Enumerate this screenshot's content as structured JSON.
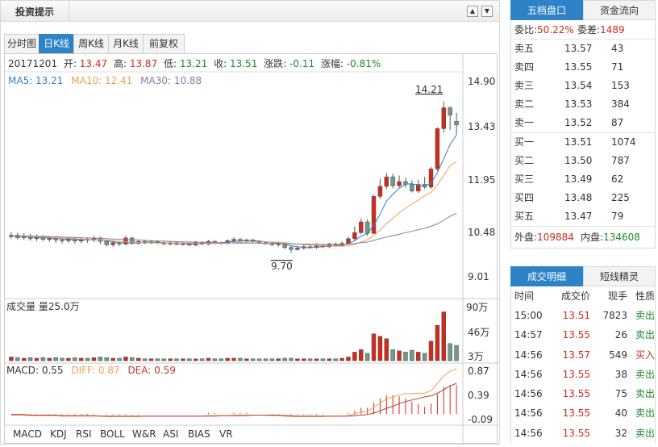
{
  "header": {
    "title": "投资提示",
    "up_icon": "▲",
    "down_icon": "▼"
  },
  "tabs": [
    {
      "label": "分时图",
      "active": false
    },
    {
      "label": "日K线",
      "active": true
    },
    {
      "label": "周K线",
      "active": false
    },
    {
      "label": "月K线",
      "active": false
    },
    {
      "label": "前复权",
      "active": false
    }
  ],
  "quote_line": {
    "date": "20171201",
    "open_label": "开:",
    "open": "13.47",
    "high_label": "高:",
    "high": "13.87",
    "low_label": "低:",
    "low": "13.21",
    "close_label": "收:",
    "close": "13.51",
    "change_label": "涨跌:",
    "change": "-0.11",
    "pct_label": "涨幅:",
    "pct": "-0.81%"
  },
  "ma_line": {
    "ma5": "MA5: 13.21",
    "ma10": "MA10: 12.41",
    "ma30": "MA30: 10.88"
  },
  "price_axis": [
    "14.90",
    "13.43",
    "11.95",
    "10.48",
    "9.01"
  ],
  "annotations": {
    "high_mark": "14.21",
    "low_mark": "9.70"
  },
  "volume": {
    "label": "成交量 量25.0万",
    "axis": [
      "90万",
      "46万",
      "3万"
    ]
  },
  "macd": {
    "macd": "MACD: 0.55",
    "diff": "DIFF: 0.87",
    "dea": "DEA: 0.59",
    "axis": [
      "0.87",
      "0.39",
      "-0.09"
    ]
  },
  "indicator_tabs": [
    "MACD",
    "KDJ",
    "RSI",
    "BOLL",
    "W&R",
    "ASI",
    "BIAS",
    "VR"
  ],
  "order_book": {
    "tabs": [
      {
        "label": "五档盘口",
        "active": true
      },
      {
        "label": "资金流向",
        "active": false
      }
    ],
    "ratio_label": "委比:",
    "ratio": "50.22%",
    "diff_label": "委差:",
    "diff": "1489",
    "sells": [
      {
        "label": "卖五",
        "price": "13.57",
        "qty": "43"
      },
      {
        "label": "卖四",
        "price": "13.55",
        "qty": "71"
      },
      {
        "label": "卖三",
        "price": "13.54",
        "qty": "153"
      },
      {
        "label": "卖二",
        "price": "13.53",
        "qty": "384"
      },
      {
        "label": "卖一",
        "price": "13.52",
        "qty": "87"
      }
    ],
    "buys": [
      {
        "label": "买一",
        "price": "13.51",
        "qty": "1074"
      },
      {
        "label": "买二",
        "price": "13.50",
        "qty": "787"
      },
      {
        "label": "买三",
        "price": "13.49",
        "qty": "62"
      },
      {
        "label": "买四",
        "price": "13.48",
        "qty": "225"
      },
      {
        "label": "买五",
        "price": "13.47",
        "qty": "79"
      }
    ],
    "outer_label": "外盘:",
    "outer": "109884",
    "inner_label": "内盘:",
    "inner": "134608"
  },
  "trades": {
    "tabs": [
      {
        "label": "成交明细",
        "active": true
      },
      {
        "label": "短线精灵",
        "active": false
      }
    ],
    "headers": [
      "时间",
      "成交价",
      "现手",
      "性质"
    ],
    "rows": [
      {
        "time": "15:00",
        "price": "13.51",
        "qty": "7823",
        "type": "卖出"
      },
      {
        "time": "14:57",
        "price": "13.55",
        "qty": "26",
        "type": "卖出"
      },
      {
        "time": "14:56",
        "price": "13.57",
        "qty": "549",
        "type": "买入"
      },
      {
        "time": "14:56",
        "price": "13.55",
        "qty": "38",
        "type": "卖出"
      },
      {
        "time": "14:56",
        "price": "13.55",
        "qty": "75",
        "type": "卖出"
      },
      {
        "time": "14:56",
        "price": "13.55",
        "qty": "40",
        "type": "卖出"
      },
      {
        "time": "14:56",
        "price": "13.55",
        "qty": "32",
        "type": "卖出"
      }
    ]
  },
  "colors": {
    "up": "#d2291a",
    "down": "#6f9a8c",
    "ma5": "#2e83c7",
    "ma10": "#f0a050",
    "ma30": "#8a7aa0",
    "accent": "#2e83c7"
  },
  "chart_data": {
    "type": "candlestick",
    "candles": [
      {
        "o": 10.18,
        "c": 10.22,
        "h": 10.32,
        "l": 10.12,
        "v": 6
      },
      {
        "o": 10.22,
        "c": 10.15,
        "h": 10.3,
        "l": 10.1,
        "v": 5
      },
      {
        "o": 10.15,
        "c": 10.2,
        "h": 10.28,
        "l": 10.08,
        "v": 4
      },
      {
        "o": 10.2,
        "c": 10.12,
        "h": 10.26,
        "l": 10.06,
        "v": 5
      },
      {
        "o": 10.12,
        "c": 10.18,
        "h": 10.24,
        "l": 10.05,
        "v": 4
      },
      {
        "o": 10.18,
        "c": 10.1,
        "h": 10.22,
        "l": 10.04,
        "v": 5
      },
      {
        "o": 10.1,
        "c": 10.14,
        "h": 10.2,
        "l": 10.02,
        "v": 4
      },
      {
        "o": 10.14,
        "c": 10.08,
        "h": 10.18,
        "l": 10.0,
        "v": 5
      },
      {
        "o": 10.08,
        "c": 10.06,
        "h": 10.15,
        "l": 9.98,
        "v": 4
      },
      {
        "o": 10.06,
        "c": 10.12,
        "h": 10.18,
        "l": 10.0,
        "v": 4
      },
      {
        "o": 10.12,
        "c": 10.05,
        "h": 10.16,
        "l": 9.98,
        "v": 5
      },
      {
        "o": 10.05,
        "c": 10.1,
        "h": 10.14,
        "l": 9.98,
        "v": 4
      },
      {
        "o": 10.1,
        "c": 10.08,
        "h": 10.16,
        "l": 10.0,
        "v": 4
      },
      {
        "o": 10.08,
        "c": 10.14,
        "h": 10.2,
        "l": 10.02,
        "v": 5
      },
      {
        "o": 10.14,
        "c": 10.04,
        "h": 10.18,
        "l": 9.96,
        "v": 6
      },
      {
        "o": 10.04,
        "c": 9.94,
        "h": 10.08,
        "l": 9.9,
        "v": 5
      },
      {
        "o": 9.94,
        "c": 10.0,
        "h": 10.06,
        "l": 9.88,
        "v": 4
      },
      {
        "o": 10.0,
        "c": 9.96,
        "h": 10.05,
        "l": 9.9,
        "v": 4
      },
      {
        "o": 9.96,
        "c": 10.14,
        "h": 10.2,
        "l": 9.92,
        "v": 6
      },
      {
        "o": 10.14,
        "c": 9.98,
        "h": 10.18,
        "l": 9.94,
        "v": 5
      },
      {
        "o": 9.98,
        "c": 10.04,
        "h": 10.1,
        "l": 9.94,
        "v": 4
      },
      {
        "o": 10.04,
        "c": 9.99,
        "h": 10.08,
        "l": 9.95,
        "v": 3
      },
      {
        "o": 9.99,
        "c": 10.03,
        "h": 10.08,
        "l": 9.96,
        "v": 3
      },
      {
        "o": 10.03,
        "c": 10.0,
        "h": 10.07,
        "l": 9.96,
        "v": 3
      },
      {
        "o": 10.0,
        "c": 9.96,
        "h": 10.04,
        "l": 9.92,
        "v": 3
      },
      {
        "o": 9.96,
        "c": 10.0,
        "h": 10.05,
        "l": 9.92,
        "v": 3
      },
      {
        "o": 10.0,
        "c": 9.95,
        "h": 10.04,
        "l": 9.92,
        "v": 3
      },
      {
        "o": 9.95,
        "c": 9.97,
        "h": 10.02,
        "l": 9.91,
        "v": 3
      },
      {
        "o": 9.97,
        "c": 9.93,
        "h": 10.0,
        "l": 9.9,
        "v": 3
      },
      {
        "o": 9.93,
        "c": 10.0,
        "h": 10.05,
        "l": 9.9,
        "v": 3
      },
      {
        "o": 10.0,
        "c": 9.96,
        "h": 10.04,
        "l": 9.92,
        "v": 3
      },
      {
        "o": 9.96,
        "c": 10.04,
        "h": 10.08,
        "l": 9.93,
        "v": 4
      },
      {
        "o": 10.04,
        "c": 10.0,
        "h": 10.08,
        "l": 9.96,
        "v": 3
      },
      {
        "o": 10.0,
        "c": 9.98,
        "h": 10.04,
        "l": 9.95,
        "v": 3
      },
      {
        "o": 9.98,
        "c": 10.06,
        "h": 10.1,
        "l": 9.95,
        "v": 4
      },
      {
        "o": 10.06,
        "c": 10.1,
        "h": 10.16,
        "l": 10.0,
        "v": 4
      },
      {
        "o": 10.1,
        "c": 10.05,
        "h": 10.14,
        "l": 10.0,
        "v": 4
      },
      {
        "o": 10.05,
        "c": 10.08,
        "h": 10.12,
        "l": 10.02,
        "v": 3
      },
      {
        "o": 10.08,
        "c": 10.04,
        "h": 10.12,
        "l": 10.0,
        "v": 3
      },
      {
        "o": 10.04,
        "c": 10.0,
        "h": 10.08,
        "l": 9.96,
        "v": 3
      },
      {
        "o": 10.0,
        "c": 9.98,
        "h": 10.04,
        "l": 9.94,
        "v": 3
      },
      {
        "o": 9.98,
        "c": 9.94,
        "h": 10.02,
        "l": 9.9,
        "v": 3
      },
      {
        "o": 9.94,
        "c": 9.98,
        "h": 10.04,
        "l": 9.88,
        "v": 3
      },
      {
        "o": 9.98,
        "c": 9.86,
        "h": 10.0,
        "l": 9.8,
        "v": 4
      },
      {
        "o": 9.86,
        "c": 9.8,
        "h": 9.92,
        "l": 9.7,
        "v": 4
      },
      {
        "o": 9.8,
        "c": 9.84,
        "h": 9.9,
        "l": 9.76,
        "v": 3
      },
      {
        "o": 9.84,
        "c": 9.88,
        "h": 9.94,
        "l": 9.8,
        "v": 3
      },
      {
        "o": 9.88,
        "c": 9.86,
        "h": 9.94,
        "l": 9.82,
        "v": 3
      },
      {
        "o": 9.86,
        "c": 9.92,
        "h": 9.98,
        "l": 9.82,
        "v": 3
      },
      {
        "o": 9.92,
        "c": 9.88,
        "h": 9.96,
        "l": 9.84,
        "v": 3
      },
      {
        "o": 9.88,
        "c": 9.96,
        "h": 10.0,
        "l": 9.84,
        "v": 3
      },
      {
        "o": 9.96,
        "c": 9.92,
        "h": 10.0,
        "l": 9.88,
        "v": 3
      },
      {
        "o": 9.92,
        "c": 9.98,
        "h": 10.04,
        "l": 9.88,
        "v": 4
      },
      {
        "o": 9.98,
        "c": 10.12,
        "h": 10.18,
        "l": 9.94,
        "v": 6
      },
      {
        "o": 10.12,
        "c": 10.3,
        "h": 10.48,
        "l": 10.06,
        "v": 14
      },
      {
        "o": 10.3,
        "c": 10.62,
        "h": 10.72,
        "l": 10.26,
        "v": 18
      },
      {
        "o": 10.62,
        "c": 10.28,
        "h": 10.7,
        "l": 10.2,
        "v": 12
      },
      {
        "o": 10.28,
        "c": 11.38,
        "h": 11.42,
        "l": 10.26,
        "v": 44
      },
      {
        "o": 11.38,
        "c": 11.68,
        "h": 11.9,
        "l": 11.3,
        "v": 40
      },
      {
        "o": 11.68,
        "c": 11.96,
        "h": 12.08,
        "l": 11.6,
        "v": 36
      },
      {
        "o": 11.96,
        "c": 11.7,
        "h": 12.06,
        "l": 11.62,
        "v": 18
      },
      {
        "o": 11.7,
        "c": 11.82,
        "h": 12.0,
        "l": 11.64,
        "v": 16
      },
      {
        "o": 11.82,
        "c": 11.74,
        "h": 11.94,
        "l": 11.64,
        "v": 14
      },
      {
        "o": 11.74,
        "c": 11.54,
        "h": 11.86,
        "l": 11.5,
        "v": 17
      },
      {
        "o": 11.54,
        "c": 11.74,
        "h": 11.88,
        "l": 11.48,
        "v": 14
      },
      {
        "o": 11.74,
        "c": 11.66,
        "h": 11.96,
        "l": 11.6,
        "v": 12
      },
      {
        "o": 11.66,
        "c": 12.2,
        "h": 12.26,
        "l": 11.6,
        "v": 32
      },
      {
        "o": 12.2,
        "c": 13.4,
        "h": 13.44,
        "l": 12.14,
        "v": 58
      },
      {
        "o": 13.4,
        "c": 14.02,
        "h": 14.21,
        "l": 13.28,
        "v": 80
      },
      {
        "o": 14.02,
        "c": 13.8,
        "h": 14.06,
        "l": 13.36,
        "v": 28
      },
      {
        "o": 13.62,
        "c": 13.51,
        "h": 13.87,
        "l": 13.21,
        "v": 25
      }
    ],
    "ma5": [
      10.2,
      10.19,
      10.18,
      10.17,
      10.16,
      10.15,
      10.14,
      10.13,
      10.11,
      10.1,
      10.1,
      10.09,
      10.08,
      10.09,
      10.09,
      10.06,
      10.03,
      10.0,
      9.99,
      9.99,
      10.0,
      10.02,
      10.01,
      10.01,
      10.0,
      9.99,
      9.98,
      9.98,
      9.96,
      9.97,
      9.96,
      9.98,
      9.99,
      10.0,
      10.02,
      10.04,
      10.05,
      10.07,
      10.07,
      10.05,
      10.03,
      10.01,
      9.99,
      9.95,
      9.91,
      9.88,
      9.86,
      9.85,
      9.87,
      9.88,
      9.9,
      9.91,
      9.93,
      9.97,
      10.06,
      10.2,
      10.27,
      10.52,
      10.85,
      11.24,
      11.44,
      11.62,
      11.74,
      11.76,
      11.71,
      11.69,
      11.77,
      12.09,
      12.5,
      12.93,
      13.21
    ],
    "ma10": [
      10.2,
      10.2,
      10.19,
      10.18,
      10.17,
      10.17,
      10.16,
      10.15,
      10.14,
      10.13,
      10.12,
      10.11,
      10.1,
      10.09,
      10.09,
      10.08,
      10.06,
      10.04,
      10.03,
      10.02,
      10.01,
      10.0,
      10.0,
      9.99,
      9.99,
      9.99,
      9.99,
      9.99,
      9.99,
      9.98,
      9.97,
      9.98,
      9.98,
      9.98,
      9.99,
      10.0,
      10.01,
      10.02,
      10.03,
      10.03,
      10.03,
      10.02,
      10.01,
      10.0,
      9.98,
      9.96,
      9.94,
      9.93,
      9.92,
      9.91,
      9.9,
      9.9,
      9.9,
      9.91,
      9.95,
      10.02,
      10.09,
      10.21,
      10.38,
      10.57,
      10.73,
      10.89,
      11.03,
      11.16,
      11.27,
      11.4,
      11.5,
      11.72,
      12.0,
      12.3,
      12.41
    ],
    "ma30": [
      10.2,
      10.2,
      10.2,
      10.2,
      10.19,
      10.19,
      10.18,
      10.18,
      10.17,
      10.16,
      10.16,
      10.15,
      10.14,
      10.14,
      10.13,
      10.12,
      10.11,
      10.1,
      10.1,
      10.09,
      10.08,
      10.07,
      10.06,
      10.05,
      10.05,
      10.04,
      10.03,
      10.03,
      10.02,
      10.02,
      10.01,
      10.01,
      10.0,
      10.0,
      10.0,
      9.99,
      9.99,
      9.99,
      9.99,
      9.99,
      9.98,
      9.98,
      9.98,
      9.97,
      9.97,
      9.96,
      9.96,
      9.96,
      9.96,
      9.95,
      9.95,
      9.95,
      9.95,
      9.96,
      9.98,
      10.0,
      10.02,
      10.07,
      10.12,
      10.17,
      10.21,
      10.25,
      10.3,
      10.34,
      10.39,
      10.43,
      10.49,
      10.56,
      10.67,
      10.79,
      10.88
    ],
    "macd_diff": [
      -0.02,
      -0.02,
      -0.02,
      -0.03,
      -0.03,
      -0.03,
      -0.03,
      -0.03,
      -0.04,
      -0.04,
      -0.04,
      -0.04,
      -0.04,
      -0.04,
      -0.04,
      -0.05,
      -0.05,
      -0.05,
      -0.05,
      -0.05,
      -0.05,
      -0.04,
      -0.04,
      -0.04,
      -0.04,
      -0.04,
      -0.04,
      -0.04,
      -0.04,
      -0.04,
      -0.04,
      -0.03,
      -0.03,
      -0.03,
      -0.03,
      -0.02,
      -0.02,
      -0.02,
      -0.02,
      -0.02,
      -0.02,
      -0.03,
      -0.03,
      -0.04,
      -0.05,
      -0.05,
      -0.05,
      -0.05,
      -0.05,
      -0.05,
      -0.04,
      -0.04,
      -0.04,
      -0.03,
      0.0,
      0.04,
      0.05,
      0.13,
      0.21,
      0.29,
      0.33,
      0.37,
      0.39,
      0.39,
      0.4,
      0.4,
      0.45,
      0.59,
      0.73,
      0.82,
      0.87
    ],
    "macd_dea": [
      -0.01,
      -0.01,
      -0.01,
      -0.02,
      -0.02,
      -0.02,
      -0.02,
      -0.02,
      -0.03,
      -0.03,
      -0.03,
      -0.03,
      -0.03,
      -0.03,
      -0.04,
      -0.04,
      -0.04,
      -0.04,
      -0.04,
      -0.04,
      -0.04,
      -0.04,
      -0.04,
      -0.04,
      -0.04,
      -0.04,
      -0.04,
      -0.04,
      -0.04,
      -0.04,
      -0.04,
      -0.04,
      -0.04,
      -0.03,
      -0.03,
      -0.03,
      -0.03,
      -0.03,
      -0.02,
      -0.02,
      -0.02,
      -0.02,
      -0.02,
      -0.03,
      -0.03,
      -0.04,
      -0.04,
      -0.04,
      -0.04,
      -0.04,
      -0.04,
      -0.04,
      -0.04,
      -0.04,
      -0.03,
      -0.02,
      -0.01,
      0.02,
      0.06,
      0.11,
      0.15,
      0.2,
      0.24,
      0.27,
      0.3,
      0.33,
      0.35,
      0.4,
      0.47,
      0.54,
      0.59
    ]
  }
}
